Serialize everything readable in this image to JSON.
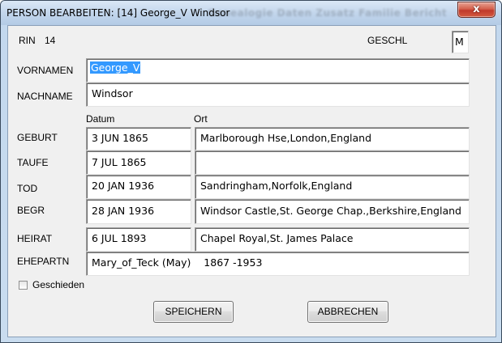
{
  "window": {
    "title": "PERSON BEARBEITEN: [14] George_V  Windsor",
    "background_title": "Genealogie  Daten  Zusatz  Familie  Bericht",
    "close_label": "x"
  },
  "record": {
    "rin_label": "RIN",
    "rin_value": "14",
    "sex_label": "GESCHL",
    "sex_value": "M"
  },
  "names": {
    "given_label": "VORNAMEN",
    "given_value": "George_V",
    "surname_label": "NACHNAME",
    "surname_value": "Windsor"
  },
  "columns": {
    "date": "Datum",
    "place": "Ort"
  },
  "events": [
    {
      "label": "GEBURT",
      "date": "3 JUN 1865",
      "place": "Marlborough Hse,London,England"
    },
    {
      "label": "TAUFE",
      "date": "7 JUL 1865",
      "place": ""
    },
    {
      "label": "TOD",
      "date": "20 JAN 1936",
      "place": "Sandringham,Norfolk,England"
    },
    {
      "label": "BEGR",
      "date": "28 JAN 1936",
      "place": "Windsor Castle,St. George Chap.,Berkshire,England"
    },
    {
      "label": "HEIRAT",
      "date": "6 JUL 1893",
      "place": "Chapel Royal,St. James Palace"
    }
  ],
  "spouse": {
    "label": "EHEPARTN",
    "value": "Mary_of_Teck (May)    1867 -1953"
  },
  "divorced": {
    "label": "Geschieden",
    "checked": false
  },
  "buttons": {
    "save": "SPEICHERN",
    "cancel": "ABBRECHEN"
  },
  "colors": {
    "selection": "#3399ff",
    "dialog_bg": "#f0f0f0",
    "frame": "#c3d8ee",
    "close": "#c0392b"
  }
}
